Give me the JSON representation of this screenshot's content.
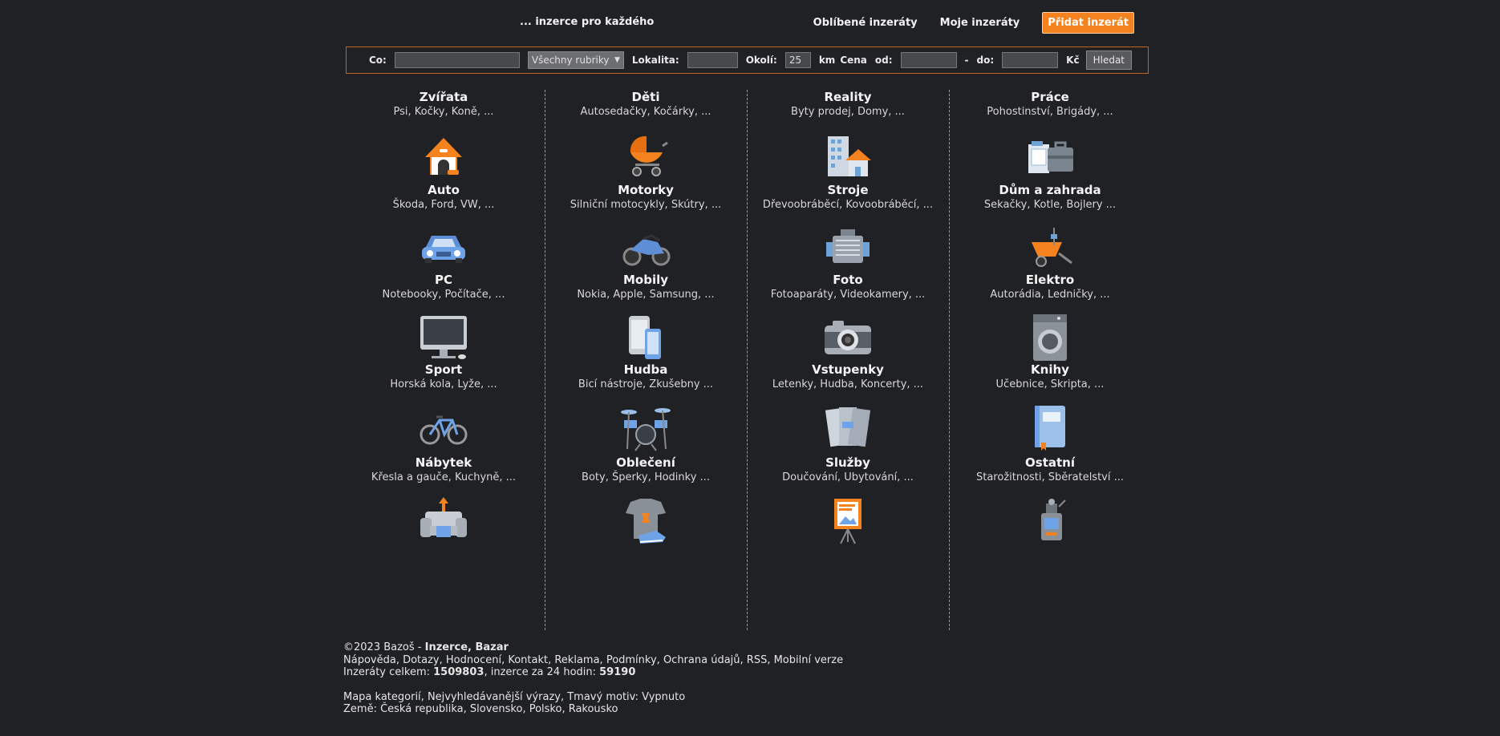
{
  "header": {
    "tagline": "... inzerce pro každého",
    "links": {
      "favorites": "Oblíbené inzeráty",
      "my_ads": "Moje inzeráty",
      "add_ad": "Přidat inzerát"
    }
  },
  "search": {
    "what_label": "Co:",
    "what_value": "",
    "category_value": "Všechny rubriky",
    "location_label": "Lokalita:",
    "location_value": "",
    "radius_label": "Okolí:",
    "radius_value": "25",
    "radius_unit": "km",
    "price_label": "Cena",
    "price_from_label": "od:",
    "price_from_value": "",
    "dash": "-",
    "price_to_label": "do:",
    "price_to_value": "",
    "currency": "Kč",
    "submit_label": "Hledat"
  },
  "categories": [
    {
      "title": "Zvířata",
      "sub": "Psi, Kočky, Koně, ...",
      "icon": "doghouse-icon"
    },
    {
      "title": "Děti",
      "sub": "Autosedačky, Kočárky, ...",
      "icon": "stroller-icon"
    },
    {
      "title": "Reality",
      "sub": "Byty prodej, Domy, ...",
      "icon": "buildings-icon"
    },
    {
      "title": "Práce",
      "sub": "Pohostinství, Brigády, ...",
      "icon": "briefcase-icon"
    },
    {
      "title": "Auto",
      "sub": "Škoda, Ford, VW, ...",
      "icon": "car-icon"
    },
    {
      "title": "Motorky",
      "sub": "Silniční motocykly, Skútry, ...",
      "icon": "motorcycle-icon"
    },
    {
      "title": "Stroje",
      "sub": "Dřevoobráběcí, Kovoobráběcí, ...",
      "icon": "engine-icon"
    },
    {
      "title": "Dům a zahrada",
      "sub": "Sekačky, Kotle, Bojlery ...",
      "icon": "wheelbarrow-icon"
    },
    {
      "title": "PC",
      "sub": "Notebooky, Počítače, ...",
      "icon": "monitor-icon"
    },
    {
      "title": "Mobily",
      "sub": "Nokia, Apple, Samsung, ...",
      "icon": "phones-icon"
    },
    {
      "title": "Foto",
      "sub": "Fotoaparáty, Videokamery, ...",
      "icon": "camera-icon"
    },
    {
      "title": "Elektro",
      "sub": "Autorádia, Ledničky, ...",
      "icon": "washing-machine-icon"
    },
    {
      "title": "Sport",
      "sub": "Horská kola, Lyže, ...",
      "icon": "bicycle-icon"
    },
    {
      "title": "Hudba",
      "sub": "Bicí nástroje, Zkušebny ...",
      "icon": "drums-icon"
    },
    {
      "title": "Vstupenky",
      "sub": "Letenky, Hudba, Koncerty, ...",
      "icon": "tickets-icon"
    },
    {
      "title": "Knihy",
      "sub": "Učebnice, Skripta, ...",
      "icon": "book-icon"
    },
    {
      "title": "Nábytek",
      "sub": "Křesla a gauče, Kuchyně, ...",
      "icon": "armchair-icon"
    },
    {
      "title": "Oblečení",
      "sub": "Boty, Šperky, Hodinky ...",
      "icon": "clothes-icon"
    },
    {
      "title": "Služby",
      "sub": "Doučování, Ubytování, ...",
      "icon": "presentation-icon"
    },
    {
      "title": "Ostatní",
      "sub": "Starožitnosti, Sběratelství ...",
      "icon": "gramophone-icon"
    }
  ],
  "footer": {
    "copyright": "©2023 Bazoš - ",
    "brand": "Inzerce, Bazar",
    "links": [
      "Nápověda",
      "Dotazy",
      "Hodnocení",
      "Kontakt",
      "Reklama",
      "Podmínky",
      "Ochrana údajů",
      "RSS",
      "Mobilní verze"
    ],
    "total_label": "Inzeráty celkem: ",
    "total_value": "1509803",
    "day_label": ", inzerce za 24 hodin: ",
    "day_value": "59190",
    "links2": [
      "Mapa kategorií",
      "Nejvyhledávanější výrazy",
      "Tmavý motiv: Vypnuto"
    ],
    "countries_label": "Země: ",
    "countries": [
      "Česká republika",
      "Slovensko",
      "Polsko",
      "Rakousko"
    ]
  },
  "colors": {
    "background": "#202124",
    "accent": "#f4821f",
    "text": "#e6e6e6"
  }
}
